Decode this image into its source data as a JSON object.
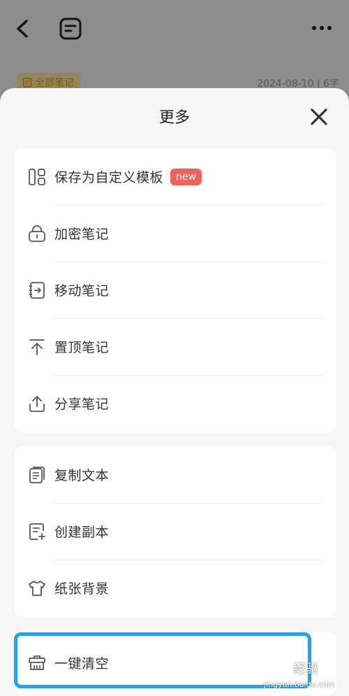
{
  "background": {
    "folder_tag": "全部笔记",
    "note_meta": "2024-08-10 | 6字"
  },
  "sheet": {
    "title": "更多",
    "groups": [
      {
        "items": [
          {
            "label": "保存为自定义模板",
            "icon": "template-icon",
            "badge": "new"
          },
          {
            "label": "加密笔记",
            "icon": "lock-icon"
          },
          {
            "label": "移动笔记",
            "icon": "move-icon"
          },
          {
            "label": "置顶笔记",
            "icon": "pin-top-icon"
          },
          {
            "label": "分享笔记",
            "icon": "share-icon"
          }
        ]
      },
      {
        "items": [
          {
            "label": "复制文本",
            "icon": "copy-icon"
          },
          {
            "label": "创建副本",
            "icon": "duplicate-icon"
          },
          {
            "label": "纸张背景",
            "icon": "shirt-icon"
          }
        ]
      },
      {
        "items": [
          {
            "label": "一键清空",
            "icon": "clear-basket-icon"
          }
        ]
      }
    ]
  },
  "watermark": {
    "text": "经验",
    "url": "jingyan.baidu.com"
  },
  "colors": {
    "badge": "#f0625a",
    "highlight": "#1ea5ee",
    "tag_bg": "#fbe7a6",
    "tag_text": "#d9a400"
  }
}
